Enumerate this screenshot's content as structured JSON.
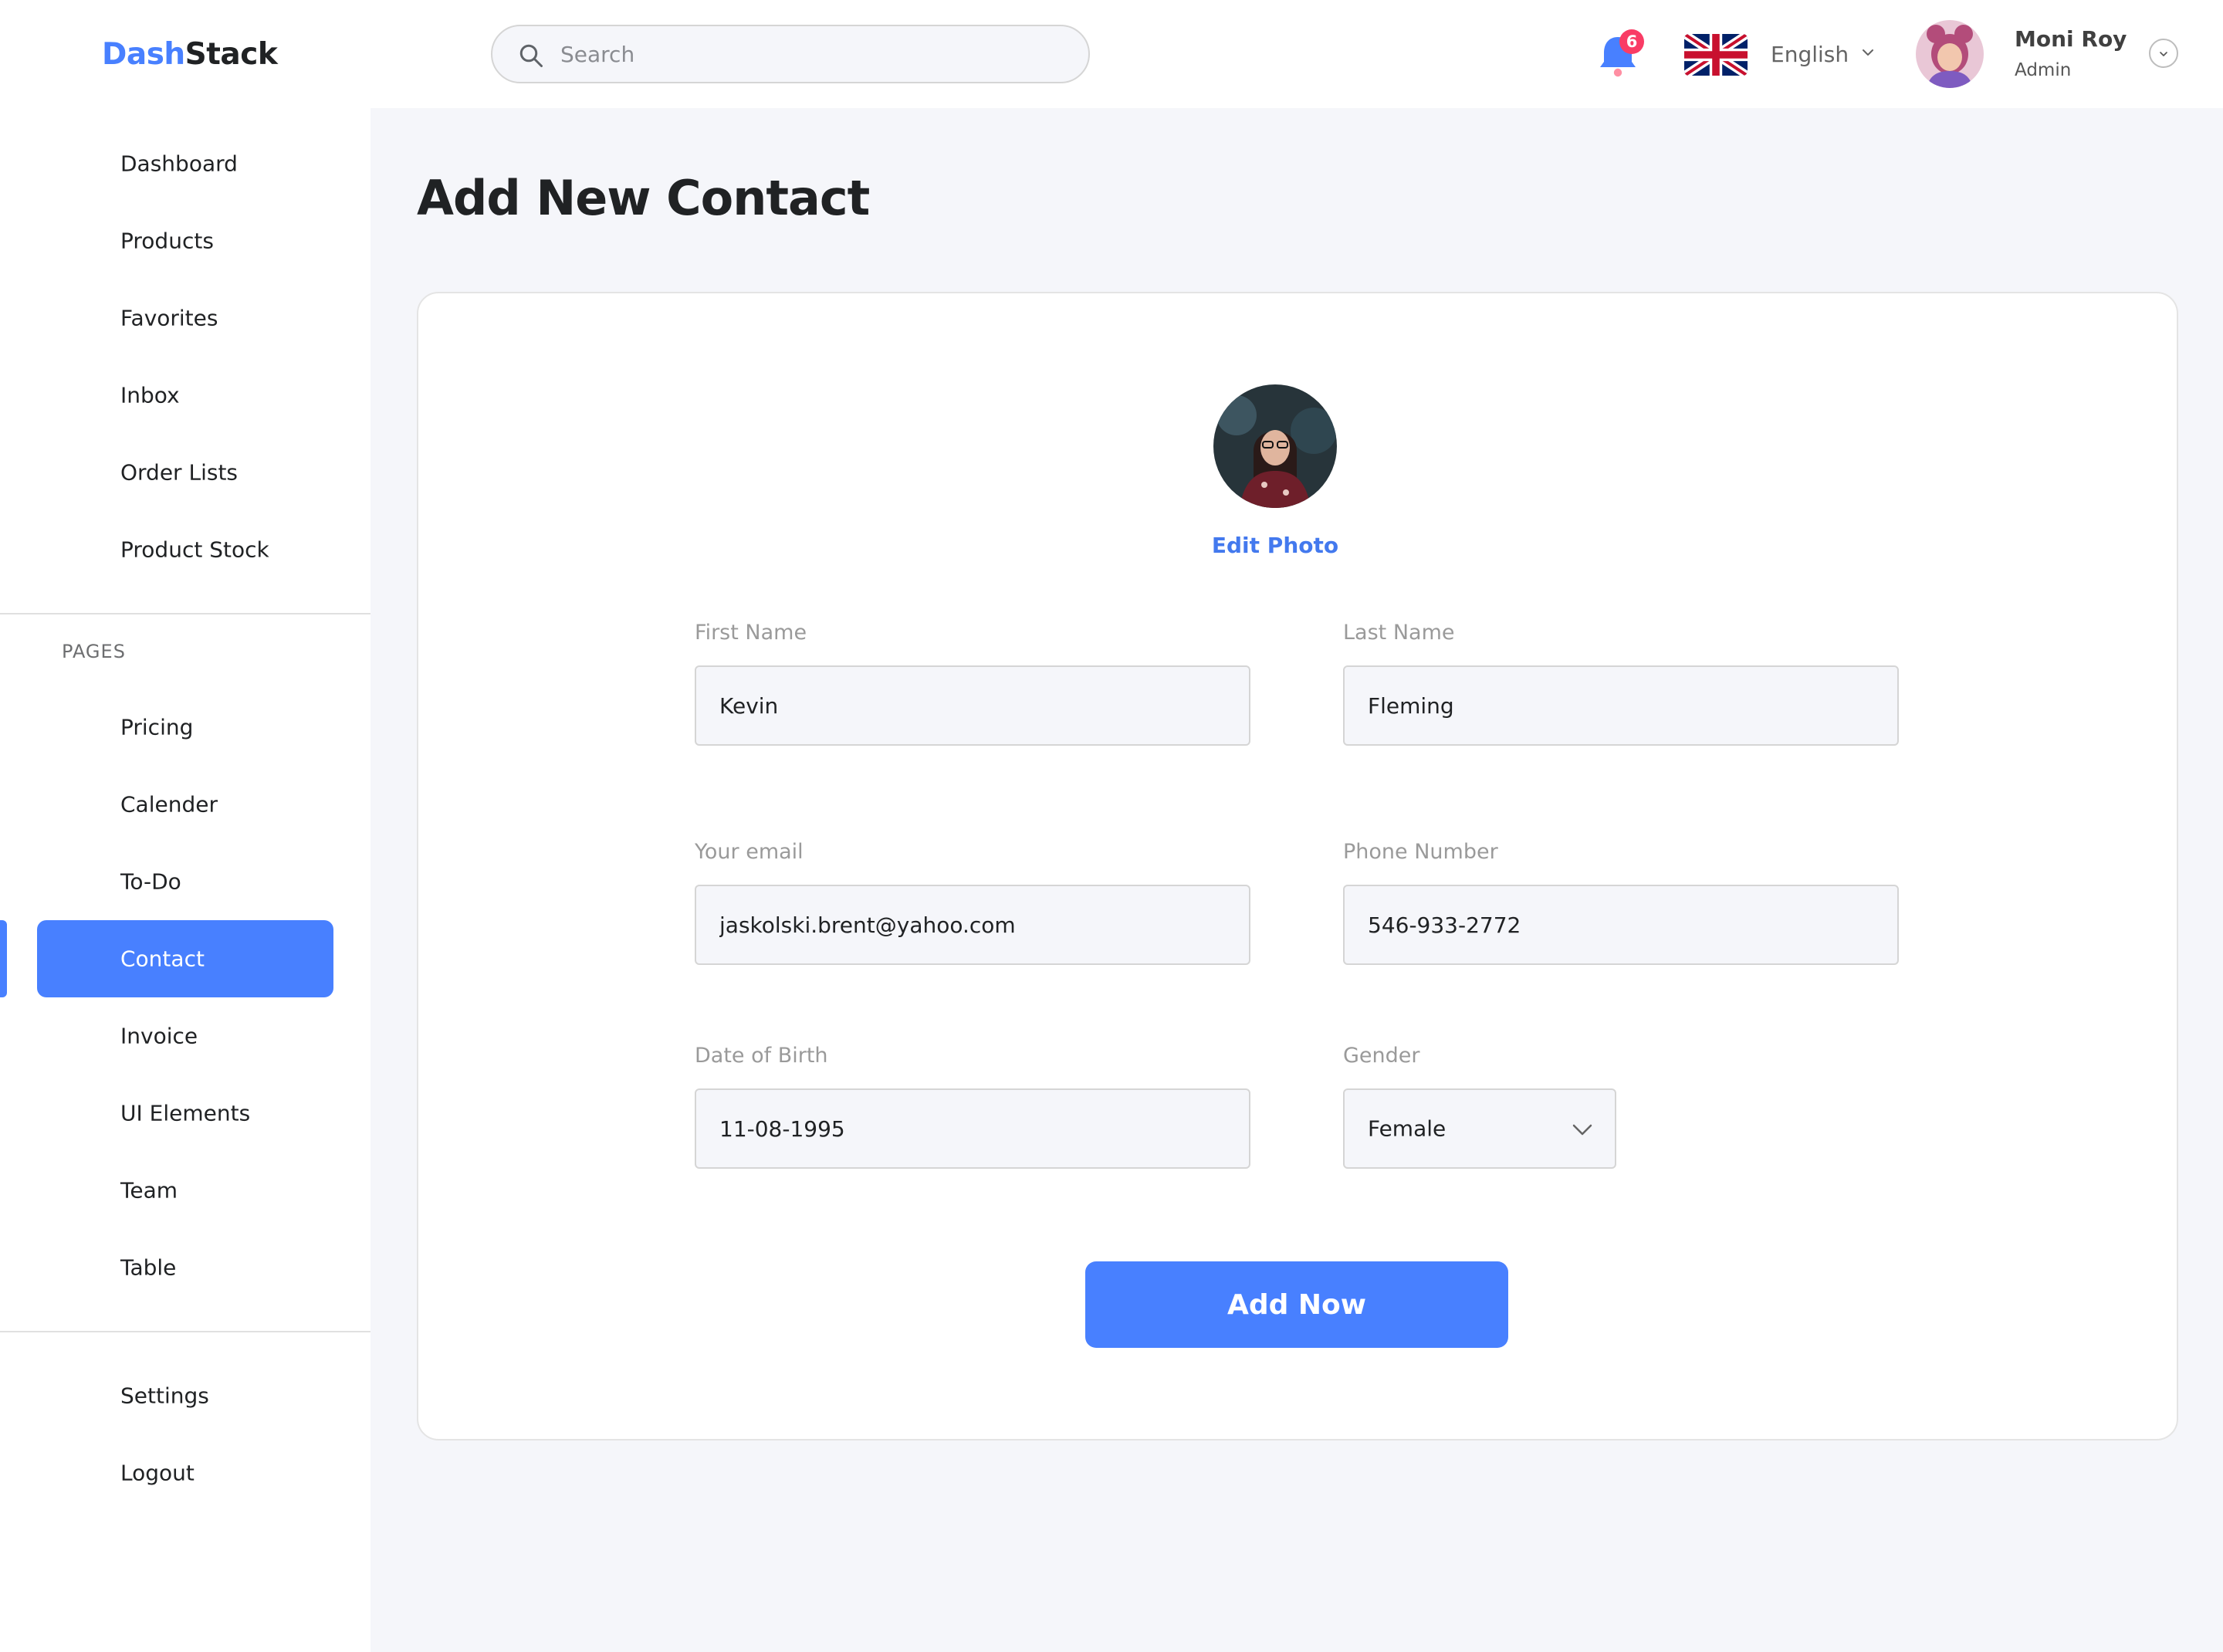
{
  "brand": {
    "part1": "Dash",
    "part2": "Stack",
    "accent": "#4880FF"
  },
  "search": {
    "placeholder": "Search",
    "icon": "search-icon"
  },
  "header": {
    "notifications": {
      "count": "6",
      "icon": "bell-icon"
    },
    "language": {
      "label": "English",
      "flag": "uk-flag-icon"
    },
    "user": {
      "name": "Moni Roy",
      "role": "Admin"
    }
  },
  "sidebar": {
    "main_items": [
      {
        "label": "Dashboard"
      },
      {
        "label": "Products"
      },
      {
        "label": "Favorites"
      },
      {
        "label": "Inbox"
      },
      {
        "label": "Order Lists"
      },
      {
        "label": "Product Stock"
      }
    ],
    "section_label": "PAGES",
    "page_items": [
      {
        "label": "Pricing"
      },
      {
        "label": "Calender"
      },
      {
        "label": "To-Do"
      },
      {
        "label": "Contact",
        "active": true
      },
      {
        "label": "Invoice"
      },
      {
        "label": "UI Elements"
      },
      {
        "label": "Team"
      },
      {
        "label": "Table"
      }
    ],
    "bottom_items": [
      {
        "label": "Settings"
      },
      {
        "label": "Logout"
      }
    ]
  },
  "main": {
    "title": "Add New Contact",
    "edit_photo": "Edit Photo",
    "form": {
      "first_name": {
        "label": "First Name",
        "value": "Kevin"
      },
      "last_name": {
        "label": "Last Name",
        "value": "Fleming"
      },
      "email": {
        "label": "Your email",
        "value": "jaskolski.brent@yahoo.com"
      },
      "phone": {
        "label": "Phone Number",
        "value": "546-933-2772"
      },
      "dob": {
        "label": "Date of Birth",
        "value": "11-08-1995"
      },
      "gender": {
        "label": "Gender",
        "value": "Female"
      }
    },
    "submit_label": "Add Now"
  },
  "colors": {
    "primary": "#4880FF",
    "badge": "#F93C65",
    "background": "#F5F6FA",
    "text": "#202224"
  }
}
